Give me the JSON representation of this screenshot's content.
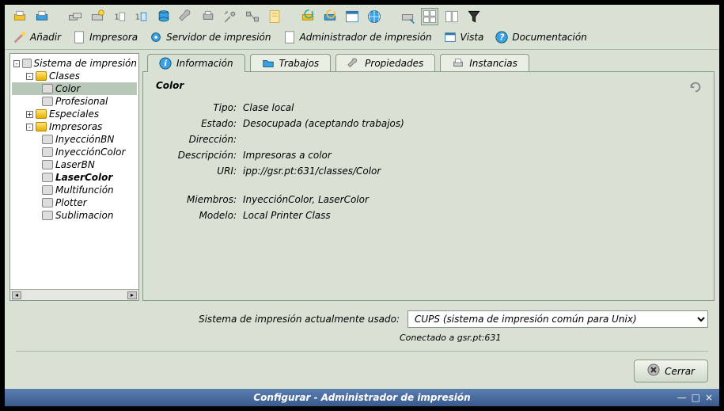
{
  "window": {
    "title": "Configurar - Administrador de impresión"
  },
  "menubar": [
    {
      "id": "add",
      "label": "Añadir",
      "accel": "A"
    },
    {
      "id": "printer",
      "label": "Impresora",
      "accel": "I"
    },
    {
      "id": "server",
      "label": "Servidor de impresión",
      "accel": "S"
    },
    {
      "id": "admin",
      "label": "Administrador de impresión",
      "accel": "A"
    },
    {
      "id": "view",
      "label": "Vista",
      "accel": "V"
    },
    {
      "id": "docs",
      "label": "Documentación",
      "accel": "D"
    }
  ],
  "tree": {
    "root": "Sistema de impresión",
    "nodes": [
      {
        "label": "Clases",
        "type": "folder",
        "expanded": true,
        "children": [
          {
            "label": "Color",
            "type": "printer",
            "selected": true
          },
          {
            "label": "Profesional",
            "type": "printer"
          }
        ]
      },
      {
        "label": "Especiales",
        "type": "folder",
        "expanded": false
      },
      {
        "label": "Impresoras",
        "type": "folder",
        "expanded": true,
        "children": [
          {
            "label": "InyecciónBN",
            "type": "printer"
          },
          {
            "label": "InyecciónColor",
            "type": "printer"
          },
          {
            "label": "LaserBN",
            "type": "printer"
          },
          {
            "label": "LaserColor",
            "type": "printer",
            "bold": true
          },
          {
            "label": "Multifunción",
            "type": "printer"
          },
          {
            "label": "Plotter",
            "type": "printer"
          },
          {
            "label": "Sublimacion",
            "type": "printer"
          }
        ]
      }
    ]
  },
  "tabs": {
    "info": "Información",
    "jobs": "Trabajos",
    "props": "Propiedades",
    "inst": "Instancias",
    "active": "info"
  },
  "detail": {
    "title": "Color",
    "fields": {
      "tipo_label": "Tipo:",
      "tipo": "Clase local",
      "estado_label": "Estado:",
      "estado": "Desocupada (aceptando trabajos)",
      "direccion_label": "Dirección:",
      "direccion": "",
      "descripcion_label": "Descripción:",
      "descripcion": "Impresoras a color",
      "uri_label": "URI:",
      "uri": "ipp://gsr.pt:631/classes/Color",
      "miembros_label": "Miembros:",
      "miembros": "InyecciónColor, LaserColor",
      "modelo_label": "Modelo:",
      "modelo": "Local Printer Class"
    }
  },
  "footer": {
    "system_label": "Sistema de impresión actualmente usado:",
    "system_value": "CUPS (sistema de impresión común para Unix)",
    "status": "Conectado a gsr.pt:631",
    "close": "Cerrar"
  }
}
